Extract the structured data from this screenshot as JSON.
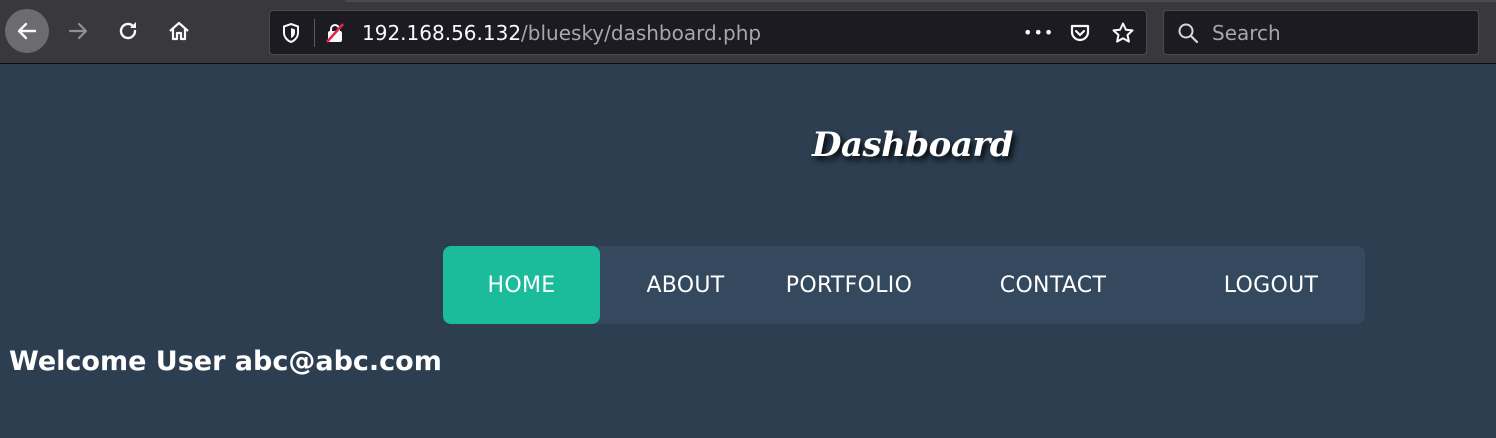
{
  "browser": {
    "url_host": "192.168.56.132",
    "url_path": "/bluesky/dashboard.php",
    "search_placeholder": "Search",
    "url_more_glyph": "•••"
  },
  "page": {
    "title": "Dashboard",
    "nav": [
      {
        "label": "HOME",
        "active": true
      },
      {
        "label": "ABOUT",
        "active": false
      },
      {
        "label": "PORTFOLIO",
        "active": false
      },
      {
        "label": "CONTACT",
        "active": false
      },
      {
        "label": "LOGOUT",
        "active": false
      }
    ],
    "welcome": "Welcome User abc@abc.com"
  },
  "colors": {
    "page_bg": "#2c3e50",
    "navbar_bg": "#34495e",
    "active_nav": "#1abc9c",
    "toolbar_bg": "#38383d",
    "urlbar_bg": "#1c1b22"
  },
  "icons": [
    "back-arrow-icon",
    "forward-arrow-icon",
    "reload-icon",
    "home-icon",
    "shield-icon",
    "insecure-lock-icon",
    "more-icon",
    "pocket-icon",
    "star-icon",
    "search-icon"
  ]
}
